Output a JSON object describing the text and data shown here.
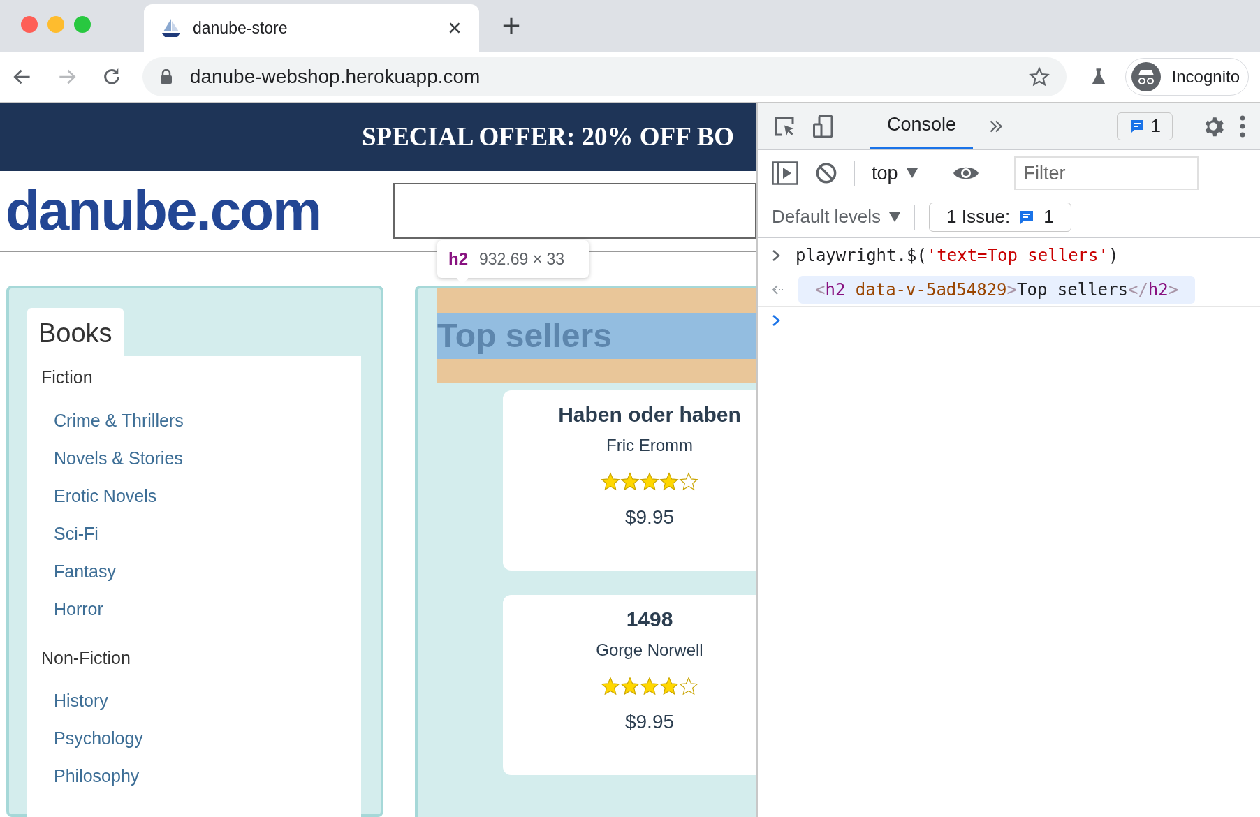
{
  "browser": {
    "tab_title": "danube-store",
    "url": "danube-webshop.herokuapp.com",
    "profile": "Incognito"
  },
  "page": {
    "banner": "SPECIAL OFFER: 20% OFF BO",
    "logo": "danube.com",
    "sidebar": {
      "tab": "Books",
      "groups": [
        {
          "label": "Fiction",
          "children": [
            {
              "label": "Crime & Thrillers"
            },
            {
              "label": "Novels & Stories"
            },
            {
              "label": "Erotic Novels"
            },
            {
              "label": "Sci-Fi"
            },
            {
              "label": "Fantasy"
            },
            {
              "label": "Horror"
            }
          ]
        },
        {
          "label": "Non-Fiction",
          "children": [
            {
              "label": "History"
            },
            {
              "label": "Psychology"
            },
            {
              "label": "Philosophy"
            }
          ]
        }
      ]
    },
    "heading": "Top sellers",
    "inspect_tooltip": {
      "tag": "h2",
      "size": "932.69 × 33"
    },
    "products": [
      {
        "title": "Haben oder haben",
        "author": "Fric Eromm",
        "stars": 4,
        "price": "$9.95"
      },
      {
        "title": "1498",
        "author": "Gorge Norwell",
        "stars": 4,
        "price": "$9.95"
      }
    ]
  },
  "devtools": {
    "tabs": [
      {
        "label": "Console",
        "selected": true
      }
    ],
    "messages_badge": "1",
    "context": "top",
    "filter": {
      "placeholder": "Filter"
    },
    "levels": "Default levels",
    "issues_label": "1 Issue:",
    "issues_count": "1",
    "console": [
      {
        "kind": "input",
        "call": "playwright.$(",
        "argument": "'text=Top sellers'",
        "call_end": ")"
      },
      {
        "kind": "output",
        "lt": "<",
        "tag": "h2",
        "attribute": " data-v-5ad54829",
        "gt": ">",
        "content": "Top sellers",
        "end_lt": "</",
        "end_tag": "h2",
        "end_gt": ">"
      },
      {
        "kind": "prompt"
      }
    ]
  }
}
